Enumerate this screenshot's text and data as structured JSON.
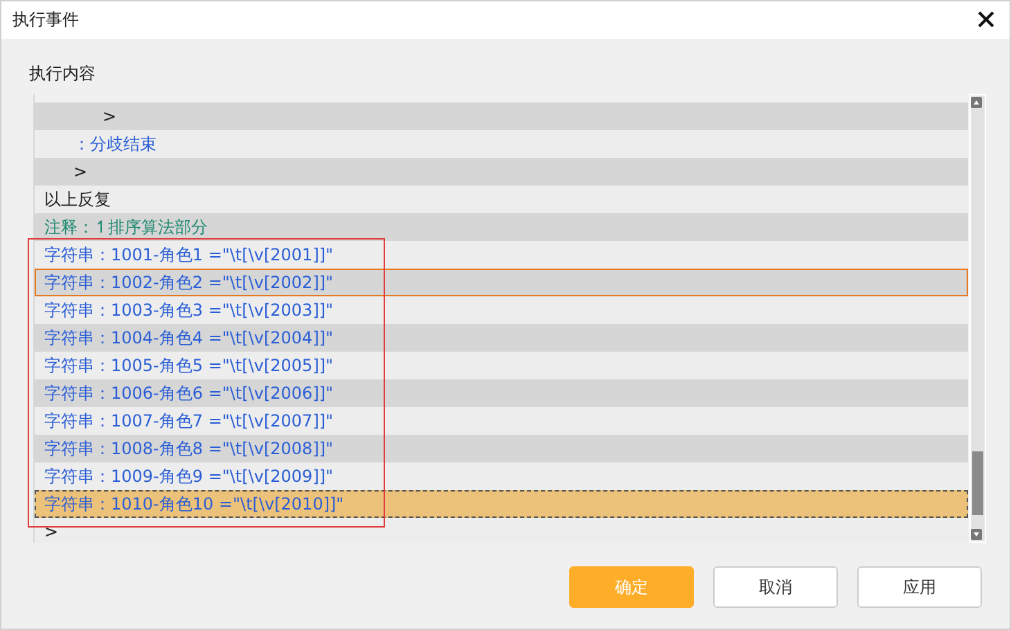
{
  "window": {
    "title": "执行事件"
  },
  "content_label": "执行内容",
  "rows": [
    {
      "kind": "group",
      "children": [
        {
          "kind": "group",
          "children": [
            {
              "kind": "plain",
              "text": ">",
              "selected": false,
              "hovered": false
            }
          ]
        },
        {
          "kind": "branch",
          "text": "：分歧结束",
          "selected": false,
          "hovered": false
        },
        {
          "kind": "plain",
          "text": ">",
          "selected": false,
          "hovered": false
        }
      ]
    },
    {
      "kind": "plain",
      "text": "以上反复",
      "selected": false,
      "hovered": false
    },
    {
      "kind": "comment",
      "text": "注释：↿排序算法部分",
      "selected": false,
      "hovered": false
    },
    {
      "kind": "string",
      "text": "字符串：1001-角色1 =\"\\t[\\v[2001]]\"",
      "selected": false,
      "hovered": false
    },
    {
      "kind": "string",
      "text": "字符串：1002-角色2 =\"\\t[\\v[2002]]\"",
      "selected": false,
      "hovered": true
    },
    {
      "kind": "string",
      "text": "字符串：1003-角色3 =\"\\t[\\v[2003]]\"",
      "selected": false,
      "hovered": false
    },
    {
      "kind": "string",
      "text": "字符串：1004-角色4 =\"\\t[\\v[2004]]\"",
      "selected": false,
      "hovered": false
    },
    {
      "kind": "string",
      "text": "字符串：1005-角色5 =\"\\t[\\v[2005]]\"",
      "selected": false,
      "hovered": false
    },
    {
      "kind": "string",
      "text": "字符串：1006-角色6 =\"\\t[\\v[2006]]\"",
      "selected": false,
      "hovered": false
    },
    {
      "kind": "string",
      "text": "字符串：1007-角色7 =\"\\t[\\v[2007]]\"",
      "selected": false,
      "hovered": false
    },
    {
      "kind": "string",
      "text": "字符串：1008-角色8 =\"\\t[\\v[2008]]\"",
      "selected": false,
      "hovered": false
    },
    {
      "kind": "string",
      "text": "字符串：1009-角色9 =\"\\t[\\v[2009]]\"",
      "selected": false,
      "hovered": false
    },
    {
      "kind": "string",
      "text": "字符串：1010-角色10 =\"\\t[\\v[2010]]\"",
      "selected": true,
      "hovered": false
    },
    {
      "kind": "plain",
      "text": ">",
      "selected": false,
      "hovered": false
    }
  ],
  "buttons": [
    {
      "label": "确定",
      "kind": "primary"
    },
    {
      "label": "取消",
      "kind": "normal"
    },
    {
      "label": "应用",
      "kind": "normal"
    }
  ]
}
